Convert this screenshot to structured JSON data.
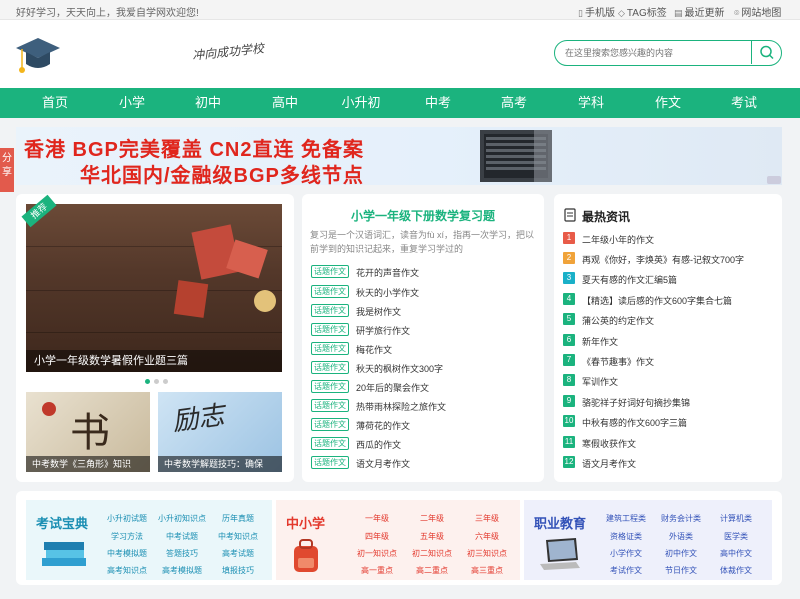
{
  "topbar": {
    "welcome": "好好学习，天天向上，我爱自学网欢迎您!",
    "links": [
      {
        "icon": "mobile-icon",
        "label": "手机版"
      },
      {
        "icon": "tag-icon",
        "label": "TAG标签"
      },
      {
        "icon": "document-icon",
        "label": "最近更新"
      },
      {
        "icon": "location-pin-icon",
        "label": "网站地图"
      }
    ]
  },
  "header": {
    "logo": "graduation-cap-icon",
    "slogan": "冲向成功学校",
    "search_placeholder": "在这里搜索您感兴趣的内容"
  },
  "nav": [
    "首页",
    "小学",
    "初中",
    "高中",
    "小升初",
    "中考",
    "高考",
    "学科",
    "作文",
    "考试"
  ],
  "banner": {
    "line1": "香港 BGP完美覆盖 CN2直连 免备案",
    "line2": "华北国内/金融级BGP多线节点",
    "share": "分享"
  },
  "featured": {
    "badge": "推荐",
    "caption": "小学一年级数学暑假作业题三篇",
    "thumbs": [
      {
        "caption": "中考数学《三角形》知识"
      },
      {
        "caption": "中考数学解题技巧：确保"
      }
    ]
  },
  "middle": {
    "title": "小学一年级下册数学复习题",
    "desc": "复习是一个汉语词汇，读音为fù xí，指再一次学习，把以前学到的知识记起来，重复学习学过的",
    "tag_label": "话题作文",
    "items": [
      "花开的声音作文",
      "秋天的小学作文",
      "我是树作文",
      "研学旅行作文",
      "梅花作文",
      "秋天的枫树作文300字",
      "20年后的聚会作文",
      "热带雨林探险之旅作文",
      "薄荷花的作文",
      "西瓜的作文",
      "语文月考作文"
    ]
  },
  "hot": {
    "title": "最热资讯",
    "items": [
      "二年级小年的作文",
      "再观《你好，李焕英》有感-记叙文700字",
      "夏天有感的作文汇编5篇",
      "【精选】读后感的作文600字集合七篇",
      "蒲公英的约定作文",
      "新年作文",
      "《春节趣事》作文",
      "军训作文",
      "骆驼祥子好词好句摘抄集锦",
      "中秋有感的作文600字三篇",
      "寒假收获作文",
      "语文月考作文"
    ],
    "colors": [
      "#e85b48",
      "#f0a33a",
      "#1ab0c8",
      "#1bb37e",
      "#1bb37e",
      "#1bb37e",
      "#1bb37e",
      "#1bb37e",
      "#1bb37e",
      "#1bb37e",
      "#1bb37e",
      "#1bb37e"
    ]
  },
  "bottom": {
    "exam": {
      "title": "考试宝典",
      "links": [
        "小升初试题",
        "小升初知识点",
        "历年真题",
        "学习方法",
        "中考试题",
        "中考知识点",
        "中考模拟题",
        "答题技巧",
        "高考试题",
        "高考知识点",
        "高考模拟题",
        "填报技巧"
      ]
    },
    "school": {
      "title": "中小学",
      "links": [
        "一年级",
        "二年级",
        "三年级",
        "四年级",
        "五年级",
        "六年级",
        "初一知识点",
        "初二知识点",
        "初三知识点",
        "高一重点",
        "高二重点",
        "高三重点"
      ]
    },
    "career": {
      "title": "职业教育",
      "links": [
        "建筑工程类",
        "财务会计类",
        "计算机类",
        "资格证类",
        "外语类",
        "医学类",
        "小学作文",
        "初中作文",
        "高中作文",
        "考试作文",
        "节日作文",
        "体裁作文"
      ]
    }
  }
}
